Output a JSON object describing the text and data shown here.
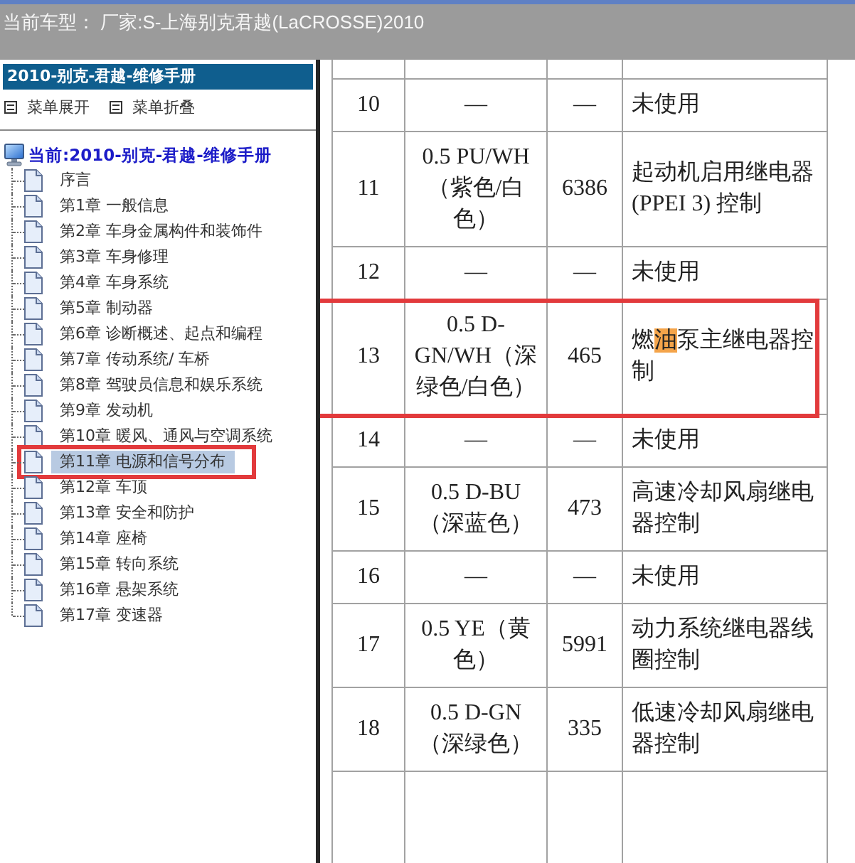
{
  "title_bar": {
    "title": "当前车型： 厂家:S-上海别克君越(LaCROSSE)2010"
  },
  "sidebar": {
    "header": "2010-别克-君越-维修手册",
    "menu_actions": [
      {
        "label": "菜单展开"
      },
      {
        "label": "菜单折叠"
      }
    ],
    "tree": {
      "label": "当前:2010-别克-君越-维修手册",
      "children": [
        {
          "label": "序言",
          "selected": false,
          "annotated": false
        },
        {
          "label": "第1章 一般信息",
          "selected": false,
          "annotated": false
        },
        {
          "label": "第2章 车身金属构件和装饰件",
          "selected": false,
          "annotated": false
        },
        {
          "label": "第3章 车身修理",
          "selected": false,
          "annotated": false
        },
        {
          "label": "第4章 车身系统",
          "selected": false,
          "annotated": false
        },
        {
          "label": "第5章 制动器",
          "selected": false,
          "annotated": false
        },
        {
          "label": "第6章 诊断概述、起点和编程",
          "selected": false,
          "annotated": false
        },
        {
          "label": "第7章 传动系统/ 车桥",
          "selected": false,
          "annotated": false
        },
        {
          "label": "第8章 驾驶员信息和娱乐系统",
          "selected": false,
          "annotated": false
        },
        {
          "label": "第9章 发动机",
          "selected": false,
          "annotated": false
        },
        {
          "label": "第10章 暖风、通风与空调系统",
          "selected": false,
          "annotated": false
        },
        {
          "label": "第11章 电源和信号分布",
          "selected": true,
          "annotated": true
        },
        {
          "label": "第12章 车顶",
          "selected": false,
          "annotated": false
        },
        {
          "label": "第13章 安全和防护",
          "selected": false,
          "annotated": false
        },
        {
          "label": "第14章 座椅",
          "selected": false,
          "annotated": false
        },
        {
          "label": "第15章 转向系统",
          "selected": false,
          "annotated": false
        },
        {
          "label": "第16章 悬架系统",
          "selected": false,
          "annotated": false
        },
        {
          "label": "第17章 变速器",
          "selected": false,
          "annotated": false
        }
      ]
    }
  },
  "table": {
    "rows": [
      {
        "cells": [
          "10",
          "—",
          "—",
          "未使用"
        ],
        "annotated": false
      },
      {
        "cells": [
          "11",
          "0.5 PU/WH（紫色/白色）",
          "6386",
          "起动机启用继电器(PPEI 3) 控制"
        ],
        "annotated": false
      },
      {
        "cells": [
          "12",
          "—",
          "—",
          "未使用"
        ],
        "annotated": false
      },
      {
        "cells": [
          "13",
          "0.5 D-GN/WH（深绿色/白色）",
          "465",
          {
            "parts": [
              {
                "text": "燃",
                "highlighted": false
              },
              {
                "text": "油",
                "highlighted": true
              },
              {
                "text": "泵主继电器控制",
                "highlighted": false
              }
            ]
          }
        ],
        "annotated": true
      },
      {
        "cells": [
          "14",
          "—",
          "—",
          "未使用"
        ],
        "annotated": false
      },
      {
        "cells": [
          "15",
          "0.5 D-BU（深蓝色）",
          "473",
          "高速冷却风扇继电器控制"
        ],
        "annotated": false
      },
      {
        "cells": [
          "16",
          "—",
          "—",
          "未使用"
        ],
        "annotated": false
      },
      {
        "cells": [
          "17",
          "0.5 YE（黄色）",
          "5991",
          "动力系统继电器线圈控制"
        ],
        "annotated": false
      },
      {
        "cells": [
          "18",
          "0.5 D-GN（深绿色）",
          "335",
          "低速冷却风扇继电器控制"
        ],
        "annotated": false
      }
    ]
  }
}
